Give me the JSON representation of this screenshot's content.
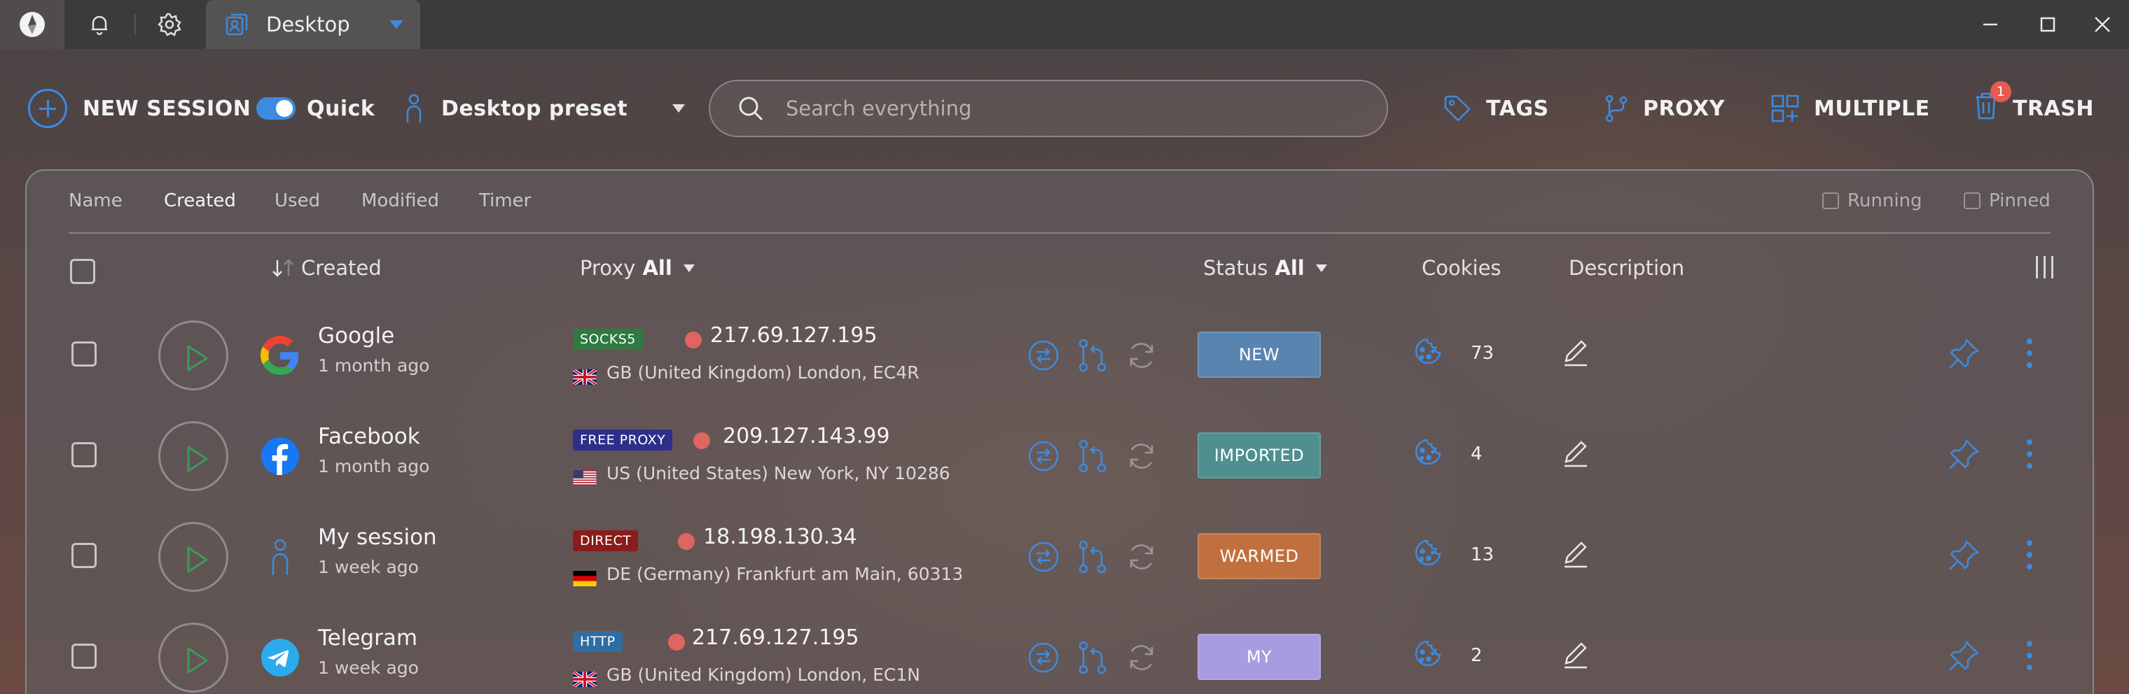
{
  "titlebar": {
    "tab_label": "Desktop"
  },
  "toolbar": {
    "new_session": "NEW SESSION",
    "quick": "Quick",
    "preset": "Desktop preset",
    "search_placeholder": "Search everything",
    "tags": "TAGS",
    "proxy": "PROXY",
    "multiple": "MULTIPLE",
    "trash": "TRASH",
    "trash_badge": "1"
  },
  "sortbar": {
    "items": [
      "Name",
      "Created",
      "Used",
      "Modified",
      "Timer"
    ],
    "active": "Created",
    "filters": [
      "Running",
      "Pinned"
    ]
  },
  "header": {
    "created": "Created",
    "proxy": "Proxy",
    "proxy_filter": "All",
    "status": "Status",
    "status_filter": "All",
    "cookies": "Cookies",
    "description": "Description"
  },
  "rows": [
    {
      "name": "Google",
      "date": "1 month ago",
      "icon": "google-icon",
      "proxy_type": "SOCKS5",
      "proxy_color": "#2f7a3f",
      "ip": "217.69.127.195",
      "flag": "gb-flag-icon",
      "location": "GB (United Kingdom) London, EC4R",
      "status": "NEW",
      "status_color": "#5a84b0",
      "cookies": "73"
    },
    {
      "name": "Facebook",
      "date": "1 month ago",
      "icon": "facebook-icon",
      "proxy_type": "FREE PROXY",
      "proxy_color": "#2d2f8a",
      "ip": "209.127.143.99",
      "flag": "us-flag-icon",
      "location": "US (United States) New York, NY 10286",
      "status": "IMPORTED",
      "status_color": "#4f8f8f",
      "cookies": "4"
    },
    {
      "name": "My session",
      "date": "1 week ago",
      "icon": "person-icon",
      "proxy_type": "DIRECT",
      "proxy_color": "#8a1c1c",
      "ip": "18.198.130.34",
      "flag": "de-flag-icon",
      "location": "DE (Germany) Frankfurt am Main, 60313",
      "status": "WARMED",
      "status_color": "#c0703f",
      "cookies": "13"
    },
    {
      "name": "Telegram",
      "date": "1 week ago",
      "icon": "telegram-icon",
      "proxy_type": "HTTP",
      "proxy_color": "#2f6da3",
      "ip": "217.69.127.195",
      "flag": "gb-flag-icon",
      "location": "GB (United Kingdom) London, EC1N",
      "status": "MY",
      "status_color": "#a99be0",
      "cookies": "2"
    }
  ],
  "colors": {
    "accent": "#3d8be0"
  }
}
